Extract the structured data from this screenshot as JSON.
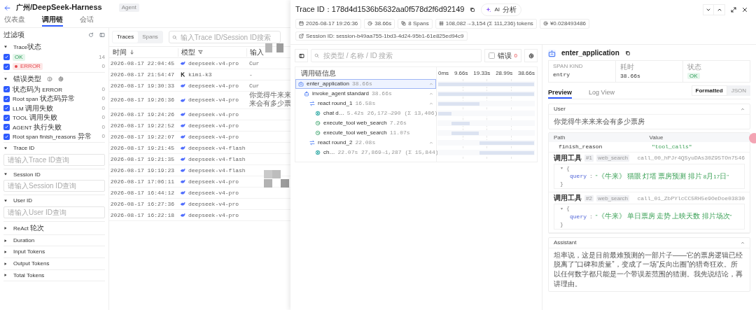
{
  "header": {
    "title": "广州/DeepSeek-Harness",
    "badge": "Agent"
  },
  "nav_tabs": [
    {
      "label": "仪表盘",
      "selected": false
    },
    {
      "label": "调用链",
      "selected": true
    },
    {
      "label": "会话",
      "selected": false
    }
  ],
  "filters": {
    "title": "过滤项",
    "sections": [
      {
        "kind": "status",
        "title": "Trace状态",
        "expanded": true,
        "options": [
          {
            "label": "OK",
            "checked": true,
            "count": "14",
            "kind": "ok"
          },
          {
            "label": "ERROR",
            "checked": true,
            "count": "0",
            "kind": "error"
          }
        ]
      },
      {
        "kind": "checks",
        "title": "错误类型",
        "expanded": true,
        "options": [
          {
            "label": "状态码为 ERROR",
            "checked": true,
            "count": "0"
          },
          {
            "label": "Root span 状态码异常",
            "checked": true,
            "count": "0"
          },
          {
            "label": "LLM 调用失败",
            "checked": true,
            "count": "0"
          },
          {
            "label": "TOOL 调用失败",
            "checked": true,
            "count": "0"
          },
          {
            "label": "AGENT 执行失败",
            "checked": true,
            "count": "0"
          },
          {
            "label": "Root span finish_reasons 异常",
            "checked": true,
            "count": "0"
          }
        ]
      },
      {
        "kind": "input",
        "title": "Trace ID",
        "expanded": true,
        "placeholder": "请输入Trace ID查询"
      },
      {
        "kind": "input",
        "title": "Session ID",
        "expanded": true,
        "placeholder": "请输入Session ID查询"
      },
      {
        "kind": "input",
        "title": "User ID",
        "expanded": true,
        "placeholder": "请输入User ID查询"
      },
      {
        "kind": "input",
        "title": "ReAct 轮次",
        "expanded": false
      },
      {
        "kind": "input",
        "title": "Duration",
        "expanded": false
      },
      {
        "kind": "input",
        "title": "Input Tokens",
        "expanded": false
      },
      {
        "kind": "input",
        "title": "Output Tokens",
        "expanded": false
      },
      {
        "kind": "input",
        "title": "Total Tokens",
        "expanded": false
      }
    ]
  },
  "list": {
    "tabs": [
      {
        "label": "Traces",
        "selected": true
      },
      {
        "label": "Spans",
        "selected": false
      }
    ],
    "search_placeholder": "输入Trace ID/Session ID搜索",
    "columns": [
      "时间",
      "模型",
      "输入"
    ],
    "rows": [
      {
        "time": "2026-08-17 22:04:45",
        "model": "deepseek-v4-pro",
        "kind": "whale",
        "input": "Cur"
      },
      {
        "time": "2026-08-17 21:54:47",
        "model": "kimi-k3",
        "kind": "mark",
        "input": "-"
      },
      {
        "time": "2026-08-17 19:30:33",
        "model": "deepseek-v4-pro",
        "kind": "whale",
        "input": "Cur"
      },
      {
        "time": "2026-08-17 19:26:36",
        "model": "deepseek-v4-pro",
        "kind": "whale",
        "input": "你觉得牛来来来会有多少票"
      },
      {
        "time": "2026-08-17 19:24:26",
        "model": "deepseek-v4-pro",
        "kind": "whale"
      },
      {
        "time": "2026-08-17 19:22:52",
        "model": "deepseek-v4-pro",
        "kind": "whale"
      },
      {
        "time": "2026-08-17 19:22:07",
        "model": "deepseek-v4-pro",
        "kind": "whale"
      },
      {
        "time": "2026-08-17 19:21:45",
        "model": "deepseek-v4-flash",
        "kind": "whale"
      },
      {
        "time": "2026-08-17 19:21:35",
        "model": "deepseek-v4-flash",
        "kind": "whale"
      },
      {
        "time": "2026-08-17 19:19:23",
        "model": "deepseek-v4-flash",
        "kind": "whale"
      },
      {
        "time": "2026-08-17 17:06:11",
        "model": "deepseek-v4-pro",
        "kind": "whale"
      },
      {
        "time": "2026-08-17 16:44:12",
        "model": "deepseek-v4-pro",
        "kind": "whale"
      },
      {
        "time": "2026-08-17 16:27:36",
        "model": "deepseek-v4-pro",
        "kind": "whale"
      },
      {
        "time": "2026-08-17 16:22:18",
        "model": "deepseek-v4-pro",
        "kind": "whale"
      }
    ]
  },
  "drawer": {
    "trace_label": "Trace ID：",
    "trace_id": "178d4d1536b5632aa0f578d2f6d92149",
    "ai_button": "AI 分析",
    "meta": [
      {
        "kind": "calendar",
        "text": "2026-08-17 19:26:36"
      },
      {
        "kind": "clock",
        "text": "38.66s"
      },
      {
        "kind": "layers",
        "text": "8 Spans"
      },
      {
        "kind": "tokens",
        "text": "108,082→3,154 (Σ 111,236) tokens"
      },
      {
        "kind": "coin",
        "text": "¥0.028493486"
      },
      {
        "kind": "link",
        "text": "Session ID: session-b49aa755-1bd3-4d24-95b1-61e825ed94c9"
      }
    ],
    "search_placeholder": "按类型 / 名称 / ID 搜索",
    "error_filter": {
      "label": "错误",
      "count": "0",
      "checked": false
    },
    "heading": "调用链信息",
    "timeline_ticks": [
      "0ms",
      "9.66s",
      "19.33s",
      "28.99s",
      "38.66s"
    ],
    "spans": [
      {
        "kind": "app",
        "name": "enter_application",
        "duration": "38.66s",
        "level": 1,
        "selected": true,
        "expanded": true,
        "children": [
          {
            "kind": "agent",
            "name": "invoke_agent standard",
            "duration": "38.66s",
            "level": 1,
            "selected": false,
            "expanded": true,
            "children": [
              {
                "kind": "round",
                "name": "react round_1",
                "duration": "16.58s",
                "level": 0.429,
                "selected": false,
                "expanded": true,
                "children": [
                  {
                    "kind": "llm",
                    "name": "chat d…",
                    "duration": "5.42s",
                    "tokens": "26,172→290 (Σ 13,406)",
                    "level": 0.14,
                    "selected": false
                  },
                  {
                    "kind": "tool",
                    "name": "execute_tool web_search",
                    "duration": "7.26s",
                    "level": 0.188,
                    "selected": false
                  },
                  {
                    "kind": "tool",
                    "name": "execute_tool web_search",
                    "duration": "11.07s",
                    "level": 0.286,
                    "selected": false
                  }
                ]
              },
              {
                "kind": "round",
                "name": "react round_2",
                "duration": "22.08s",
                "level": 0.571,
                "selected": false,
                "expanded": true,
                "children": [
                  {
                    "kind": "llm",
                    "name": "ch…",
                    "duration": "22.07s",
                    "tokens": "27,869→1,287 (Σ 15,844)",
                    "level": 0.571,
                    "selected": false
                  }
                ]
              }
            ]
          }
        ]
      }
    ]
  },
  "detail": {
    "title": "enter_application",
    "stats": [
      {
        "label": "SPAN KIND",
        "value": "entry",
        "kind": "text"
      },
      {
        "label": "耗时",
        "value": "38.66s",
        "kind": "text"
      },
      {
        "label": "状态",
        "value": "OK",
        "kind": "badge"
      }
    ],
    "tabs": [
      {
        "label": "Preview",
        "selected": true
      },
      {
        "label": "Log View",
        "selected": false
      }
    ],
    "formats": [
      {
        "label": "Formatted",
        "selected": true
      },
      {
        "label": "JSON",
        "selected": false
      }
    ],
    "user": {
      "heading": "User",
      "expanded": true,
      "text": "你觉得牛来来来会有多少票房"
    },
    "fields": {
      "columns": [
        "Path",
        "Value"
      ],
      "rows": [
        {
          "path": "finish_reason",
          "value": "\"tool_calls\""
        }
      ]
    },
    "tool_calls": [
      {
        "label": "调用工具",
        "index": "#1",
        "tool": "web_search",
        "call_id": "call_00_hPJr4QSyuDAs30Z95TOn7546",
        "open": "{",
        "key": "query",
        "colon": ":",
        "value": "\"《牛来》 猫眼 灯塔 票房预测 排片 8月17日\"",
        "close": "}"
      },
      {
        "label": "调用工具",
        "index": "#2",
        "tool": "web_search",
        "call_id": "call_01_ZbPYlcCC5RH5e9OeDoe03830",
        "open": "{",
        "key": "query",
        "colon": ":",
        "value": "\"《牛来》 单日票房 走势 上映天数 排片场次\"",
        "close": "}"
      }
    ],
    "assistant": {
      "heading": "Assistant",
      "expanded": true,
      "text": "坦率说，这是目前最难预测的一部片子——它的票房逻辑已经脱离了“口碑和质量”，变成了一场“反向出圈”的猎奇狂欢。所以任何数字都只能是一个带误差范围的猜测。我先说结论，再讲理由。"
    }
  }
}
